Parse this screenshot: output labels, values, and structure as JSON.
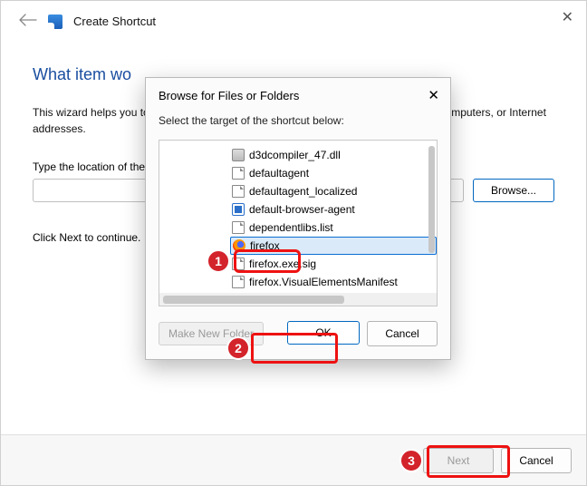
{
  "wizard": {
    "title": "Create Shortcut",
    "heading": "What item wo",
    "description": "This wizard helps you to create shortcuts to local or network programs, files, folders, computers, or Internet addresses.",
    "loc_label": "Type the location of the item:",
    "loc_value": "",
    "browse_label": "Browse...",
    "click_next": "Click Next to continue.",
    "next_label": "Next",
    "cancel_label": "Cancel"
  },
  "dialog": {
    "title": "Browse for Files or Folders",
    "subtitle": "Select the target of the shortcut below:",
    "make_folder_label": "Make New Folder",
    "ok_label": "OK",
    "cancel_label": "Cancel",
    "files": [
      {
        "name": "d3dcompiler_47.dll",
        "icon": "gear",
        "selected": false
      },
      {
        "name": "defaultagent",
        "icon": "doc",
        "selected": false
      },
      {
        "name": "defaultagent_localized",
        "icon": "doc",
        "selected": false
      },
      {
        "name": "default-browser-agent",
        "icon": "app",
        "selected": false
      },
      {
        "name": "dependentlibs.list",
        "icon": "doc",
        "selected": false
      },
      {
        "name": "firefox",
        "icon": "firefox",
        "selected": true
      },
      {
        "name": "firefox.exe.sig",
        "icon": "doc",
        "selected": false
      },
      {
        "name": "firefox.VisualElementsManifest",
        "icon": "doc",
        "selected": false
      }
    ]
  },
  "annotations": {
    "b1": "1",
    "b2": "2",
    "b3": "3"
  }
}
